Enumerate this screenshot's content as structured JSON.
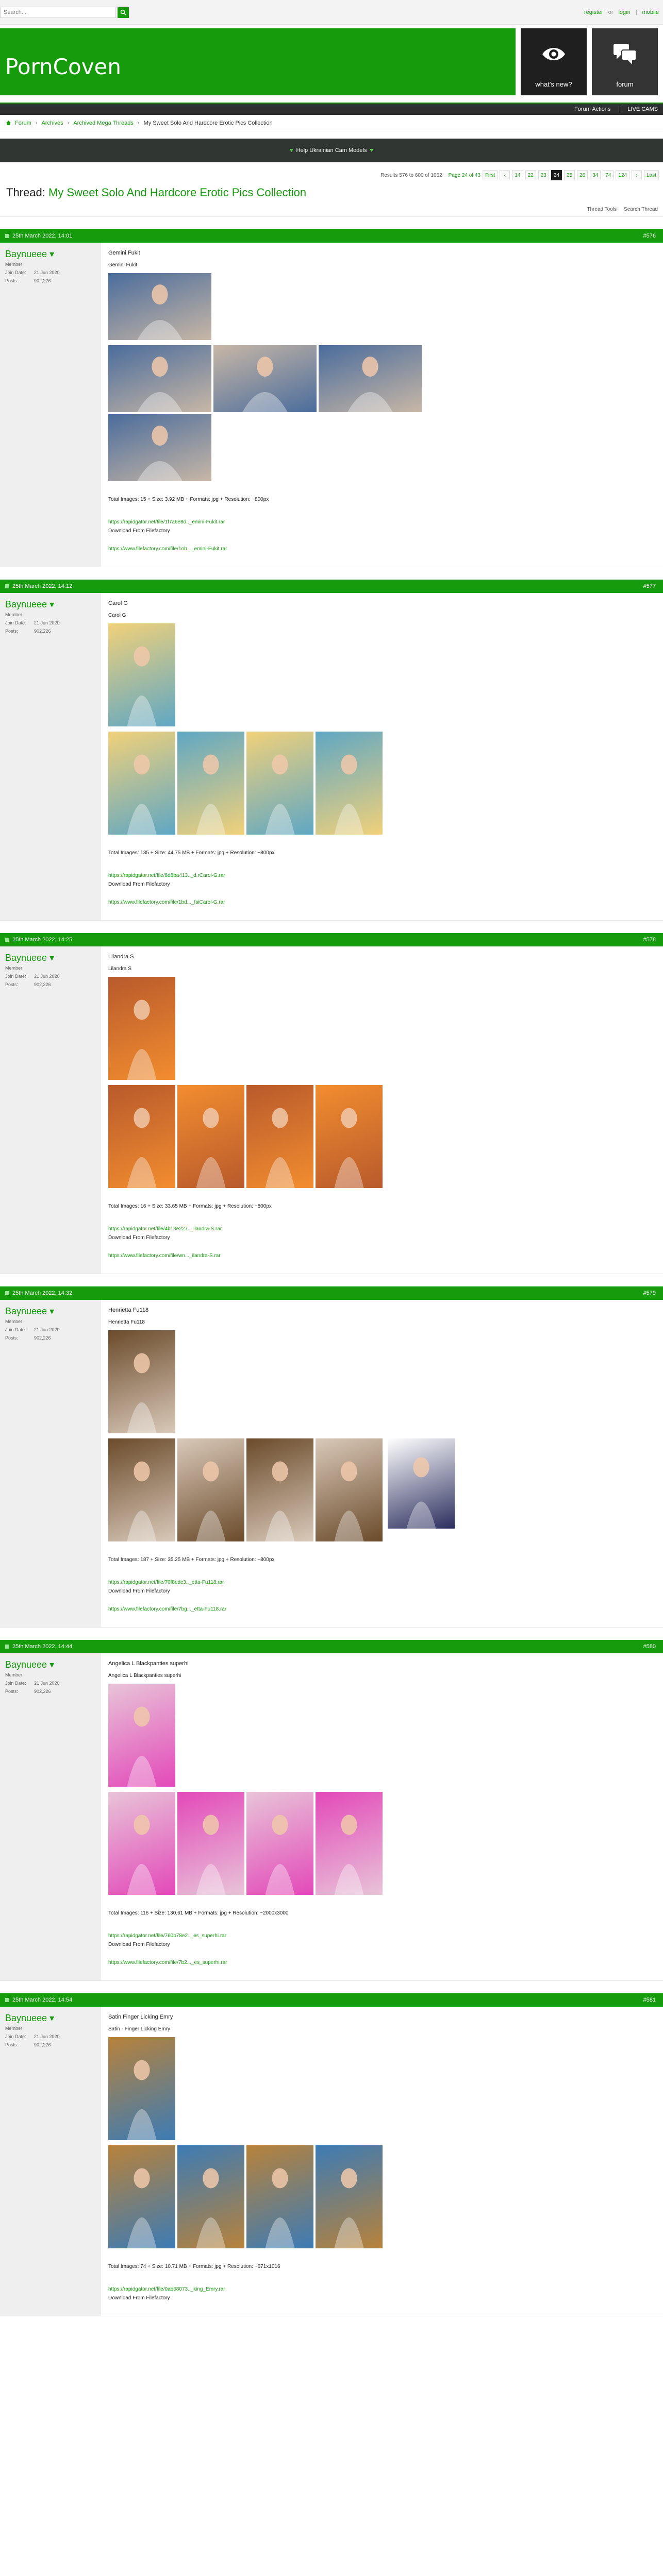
{
  "search": {
    "placeholder": "Search..."
  },
  "account": {
    "register": "register",
    "or": "or",
    "login": "login",
    "mobile": "mobile"
  },
  "header": {
    "logo": "PornCoven",
    "whats_new": "what's new?",
    "forum": "forum"
  },
  "actions_bar": {
    "forum_actions": "Forum Actions",
    "live_cams": "LIVE CAMS"
  },
  "breadcrumb": [
    "Forum",
    "Archives",
    "Archived Mega Threads",
    "My Sweet Solo And Hardcore Erotic Pics Collection"
  ],
  "notice": {
    "text": "Help Ukrainian Cam Models"
  },
  "pagination": {
    "count": "Results 576 to 600 of 1062",
    "page_of": "Page 24 of 43",
    "first": "First",
    "prev": "‹",
    "pages": [
      "14",
      "22",
      "23",
      "24",
      "25",
      "26",
      "34",
      "74",
      "124"
    ],
    "active": "24",
    "next": "›",
    "last": "Last"
  },
  "thread": {
    "label": "Thread:",
    "title": "My Sweet Solo And Hardcore Erotic Pics Collection",
    "tools": "Thread Tools",
    "search": "Search Thread"
  },
  "colors": {
    "accent": "#159b0c",
    "dark": "#222222"
  },
  "posts": [
    {
      "date": "25th March 2022, 14:01",
      "number": "#576",
      "user": "Baynueee",
      "role": "Member",
      "join_label": "Join Date:",
      "join": "21 Jun 2020",
      "posts_label": "Posts:",
      "posts": "902,226",
      "title": "Gemini Fukit",
      "subtitle": "Gemini Fukit",
      "meta": "Total Images: 15 + Size: 3.92 MB + Formats: jpg + Resolution: ~800px",
      "link1": "https://rapidgator.net/file/1f7a6e8d.._emini-Fukit.rar",
      "download": "Download From Filefactory",
      "link2": "https://www.filefactory.com/file/1ob..._emini-Fukit.rar"
    },
    {
      "date": "25th March 2022, 14:12",
      "number": "#577",
      "user": "Baynueee",
      "role": "Member",
      "join_label": "Join Date:",
      "join": "21 Jun 2020",
      "posts_label": "Posts:",
      "posts": "902,226",
      "title": "Carol G",
      "subtitle": "Carol G",
      "meta": "Total Images: 135 + Size: 44.75 MB + Formats: jpg + Resolution: ~800px",
      "link1": "https://rapidgator.net/file/8d8ba413.._d.rCarol-G.rar",
      "download": "Download From Filefactory",
      "link2": "https://www.filefactory.com/file/1bd..._fsiCarol-G.rar"
    },
    {
      "date": "25th March 2022, 14:25",
      "number": "#578",
      "user": "Baynueee",
      "role": "Member",
      "join_label": "Join Date:",
      "join": "21 Jun 2020",
      "posts_label": "Posts:",
      "posts": "902,226",
      "title": "Lilandra S",
      "subtitle": "Lilandra S",
      "meta": "Total Images: 16 + Size: 33.65 MB + Formats: jpg + Resolution: ~800px",
      "link1": "https://rapidgator.net/file/4b13e227.._ilandra-S.rar",
      "download": "Download From Filefactory",
      "link2": "https://www.filefactory.com/file/wn..._ilandra-S.rar"
    },
    {
      "date": "25th March 2022, 14:32",
      "number": "#579",
      "user": "Baynueee",
      "role": "Member",
      "join_label": "Join Date:",
      "join": "21 Jun 2020",
      "posts_label": "Posts:",
      "posts": "902,226",
      "title": "Henrietta Fu118",
      "subtitle": "Henrietta Fu118",
      "meta": "Total Images: 187 + Size: 35.25 MB + Formats: jpg + Resolution: ~800px",
      "link1": "https://rapidgator.net/file/70f8edc3.._etta-Fu118.rar",
      "download": "Download From Filefactory",
      "link2": "https://www.filefactory.com/file/7bg..._etta-Fu118.rar"
    },
    {
      "date": "25th March 2022, 14:44",
      "number": "#580",
      "user": "Baynueee",
      "role": "Member",
      "join_label": "Join Date:",
      "join": "21 Jun 2020",
      "posts_label": "Posts:",
      "posts": "902,226",
      "title": "Angelica L Blackpanties superhi",
      "subtitle": "Angelica L Blackpanties superhi",
      "meta": "Total Images: 116 + Size: 130.61 MB + Formats: jpg + Resolution: ~2000x3000",
      "link1": "https://rapidgator.net/file/760b78e2.._es_superhi.rar",
      "download": "Download From Filefactory",
      "link2": "https://www.filefactory.com/file/7b2..._es_superhi.rar"
    },
    {
      "date": "25th March 2022, 14:54",
      "number": "#581",
      "user": "Baynueee",
      "role": "Member",
      "join_label": "Join Date:",
      "join": "21 Jun 2020",
      "posts_label": "Posts:",
      "posts": "902,226",
      "title": "Satin Finger Licking Emry",
      "subtitle": "Satin - Finger Licking Emry",
      "meta": "Total Images: 74 + Size: 10.71 MB + Formats: jpg + Resolution: ~671x1016",
      "link1": "https://rapidgator.net/file/0ab68073.._king_Emry.rar",
      "download": "Download From Filefactory",
      "link2": ""
    }
  ]
}
